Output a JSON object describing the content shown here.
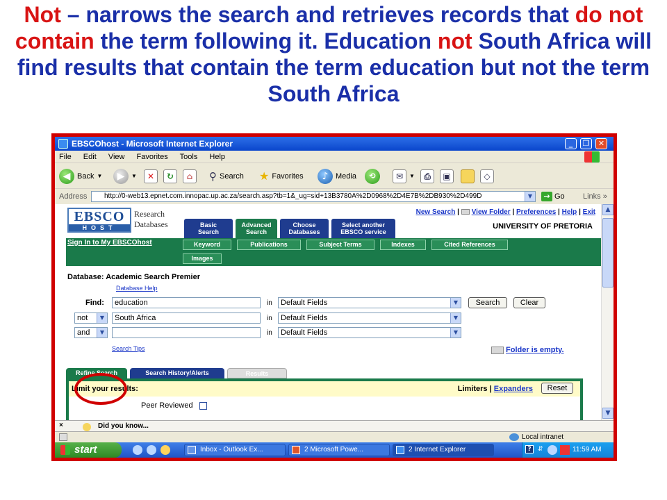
{
  "caption": {
    "w1": "Not",
    "t1": " – narrows the search and retrieves records that ",
    "w2": "do not contain",
    "t2": " the term following it. Education ",
    "w3": "not",
    "t3": " South Africa will find results that contain the term education but not the term South Africa"
  },
  "window": {
    "title": "EBSCOhost - Microsoft Internet Explorer",
    "minimize": "_",
    "maximize": "❐",
    "close": "✕"
  },
  "menu": [
    "File",
    "Edit",
    "View",
    "Favorites",
    "Tools",
    "Help"
  ],
  "toolbar": {
    "back": "Back",
    "search": "Search",
    "favorites": "Favorites",
    "media": "Media"
  },
  "address": {
    "label": "Address",
    "url": "http://0-web13.epnet.com.innopac.up.ac.za/search.asp?tb=1&_ug=sid+13B3780A%2D0968%2D4E7B%2DB930%2D499D",
    "go": "Go",
    "links": "Links"
  },
  "ebsco": {
    "logo_top": "EBSCO",
    "logo_bottom": "HOST",
    "logo_text_1": "Research",
    "logo_text_2": "Databases",
    "links": [
      "New Search",
      "View Folder",
      "Preferences",
      "Help",
      "Exit"
    ],
    "institution": "UNIVERSITY OF PRETORIA",
    "nav_tabs": [
      {
        "l1": "Basic",
        "l2": "Search"
      },
      {
        "l1": "Advanced",
        "l2": "Search"
      },
      {
        "l1": "Choose",
        "l2": "Databases"
      },
      {
        "l1": "Select another",
        "l2": "EBSCO service"
      }
    ],
    "signin": "Sign In to My EBSCOhost",
    "sub_tabs": [
      "Keyword",
      "Publications",
      "Subject Terms",
      "Indexes",
      "Cited References",
      "Images"
    ]
  },
  "search": {
    "database": "Database: Academic Search Premier",
    "database_help": "Database Help",
    "find_label": "Find:",
    "rows": [
      {
        "bool": "",
        "term": "education",
        "in": "in",
        "field": "Default Fields"
      },
      {
        "bool": "not",
        "term": "South Africa",
        "in": "in",
        "field": "Default Fields"
      },
      {
        "bool": "and",
        "term": "",
        "in": "in",
        "field": "Default Fields"
      }
    ],
    "search_button": "Search",
    "clear_button": "Clear",
    "search_tips": "Search Tips",
    "folder": "Folder is empty."
  },
  "results_tabs": [
    "Refine Search",
    "Search History/Alerts",
    "Results"
  ],
  "limits": {
    "heading": "Limit your results:",
    "limiters": "Limiters",
    "expanders": "Expanders",
    "reset": "Reset",
    "peer_reviewed": "Peer Reviewed"
  },
  "bottom_pane": {
    "close": "×",
    "text": "Did you know..."
  },
  "status": {
    "zone": "Local intranet"
  },
  "taskbar": {
    "start": "start",
    "tasks": [
      "Inbox - Outlook Ex...",
      "2 Microsoft Powe...",
      "2 Internet Explorer"
    ],
    "clock": "11:59 AM"
  },
  "colors": {
    "frame": "#d00000",
    "ebsco_green": "#1a7a4a",
    "ebsco_blue": "#1f3c8f",
    "link": "#1a36c8"
  }
}
